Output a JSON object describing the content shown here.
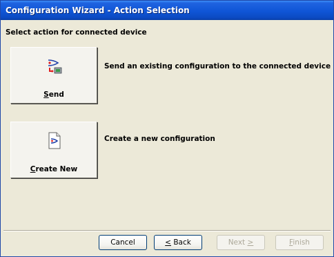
{
  "window": {
    "title": "Configuration Wizard - Action Selection"
  },
  "header": {
    "subtitle": "Select action for connected device"
  },
  "actions": [
    {
      "label_prefix": "",
      "label_mnemonic": "S",
      "label_suffix": "end",
      "description": "Send an existing configuration to the connected device",
      "icon": "send-config-icon"
    },
    {
      "label_prefix": "",
      "label_mnemonic": "C",
      "label_suffix": "reate New",
      "description": "Create a new configuration",
      "icon": "new-config-document-icon"
    }
  ],
  "footer": {
    "cancel": {
      "label": "Cancel",
      "enabled": true
    },
    "back": {
      "label_mnemonic": "<",
      "label_suffix": " Back",
      "enabled": true
    },
    "next": {
      "label_prefix": "Next ",
      "label_mnemonic": ">",
      "enabled": false
    },
    "finish": {
      "label_mnemonic": "F",
      "label_suffix": "inish",
      "enabled": false
    }
  },
  "colors": {
    "titlebar": "#0f55d6",
    "dialog_bg": "#ece9d8",
    "accent_red": "#e02020",
    "accent_blue": "#1f3fa8"
  }
}
